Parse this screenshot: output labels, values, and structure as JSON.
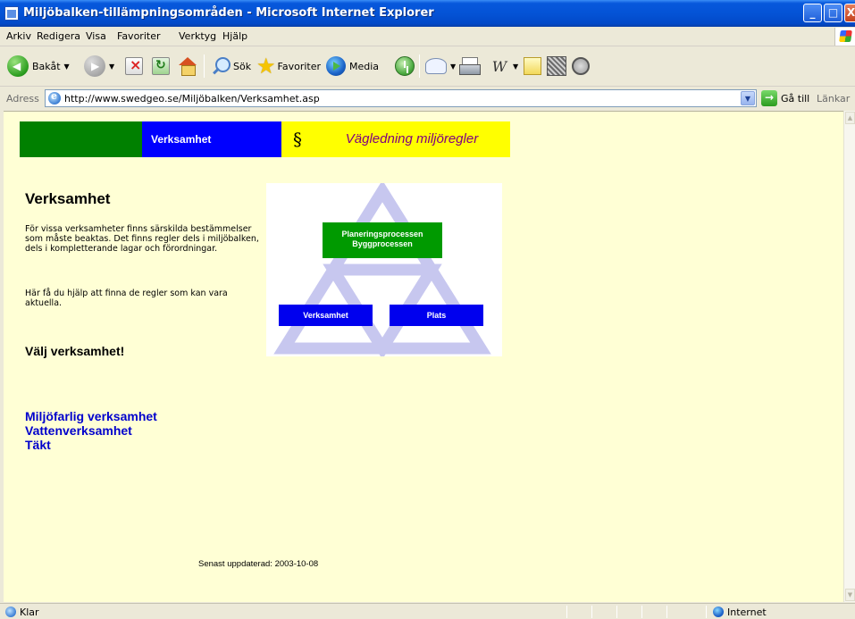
{
  "window": {
    "title": "Miljöbalken-tillämpningsområden - Microsoft Internet Explorer",
    "buttons": {
      "minimize": "_",
      "maximize": "□",
      "close": "X"
    }
  },
  "menu": [
    {
      "label": "Arkiv"
    },
    {
      "label": "Redigera"
    },
    {
      "label": "Visa"
    },
    {
      "label": "Favoriter"
    },
    {
      "label": "Verktyg"
    },
    {
      "label": "Hjälp"
    }
  ],
  "toolbar": {
    "back": "Bakåt",
    "search": "Sök",
    "favorites": "Favoriter",
    "media": "Media",
    "word": "W"
  },
  "address": {
    "label": "Adress",
    "url": "http://www.swedgeo.se/Miljöbalken/Verksamhet.asp",
    "go": "Gå till",
    "links": "Länkar"
  },
  "page": {
    "band": {
      "section": "Verksamhet",
      "paragraph_symbol": "§",
      "title": "Vägledning miljöregler"
    },
    "heading": "Verksamhet",
    "paragraph1": "För vissa verksamheter finns särskilda bestämmelser som måste beaktas. Det finns regler dels i miljöbalken, dels i kompletterande lagar och förordningar.",
    "paragraph2": "Här få du hjälp att finna de regler som kan vara aktuella.",
    "choose": "Välj verksamhet!",
    "links": [
      "Miljöfarlig verksamhet",
      "Vattenverksamhet",
      "Täkt"
    ],
    "diagram": {
      "green_line1": "Planeringsprocessen",
      "green_line2": "Byggprocessen",
      "blue_left": "Verksamhet",
      "blue_right": "Plats"
    },
    "updated": "Senast uppdaterad: 2003-10-08"
  },
  "status": {
    "text": "Klar",
    "zone": "Internet"
  },
  "colors": {
    "page_bg": "#ffffd5",
    "green": "#008000",
    "blue": "#0000ff",
    "yellow": "#ffff00",
    "purple": "#800080",
    "link": "#0000cc"
  }
}
